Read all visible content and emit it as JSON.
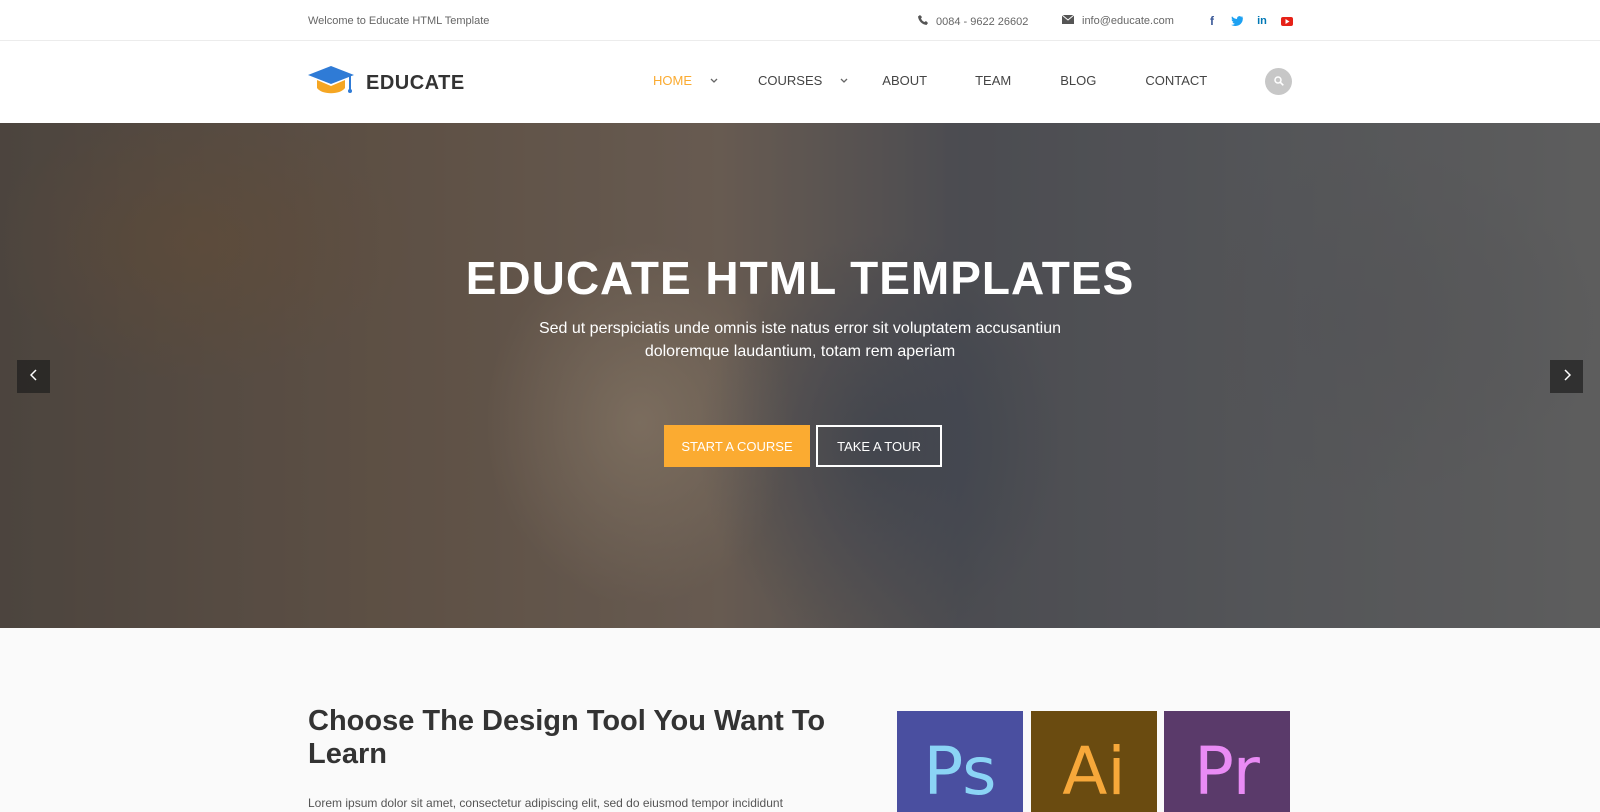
{
  "topbar": {
    "welcome": "Welcome to Educate HTML Template",
    "phone": "0084 - 9622 26602",
    "email": "info@educate.com",
    "socials": [
      {
        "name": "facebook-icon",
        "glyph": "f",
        "color": "#3b5998"
      },
      {
        "name": "twitter-icon",
        "glyph": "t",
        "color": "#1da1f2"
      },
      {
        "name": "linkedin-icon",
        "glyph": "in",
        "color": "#0077b5"
      },
      {
        "name": "youtube-icon",
        "glyph": "▶",
        "color": "#e62117"
      }
    ]
  },
  "header": {
    "logo_text": "EDUCATE",
    "nav": [
      {
        "label": "HOME",
        "has_dropdown": true,
        "active": true
      },
      {
        "label": "COURSES",
        "has_dropdown": true,
        "active": false
      },
      {
        "label": "ABOUT",
        "has_dropdown": false,
        "active": false
      },
      {
        "label": "TEAM",
        "has_dropdown": false,
        "active": false
      },
      {
        "label": "BLOG",
        "has_dropdown": false,
        "active": false
      },
      {
        "label": "CONTACT",
        "has_dropdown": false,
        "active": false
      }
    ]
  },
  "hero": {
    "title": "EDUCATE HTML TEMPLATES",
    "subtitle": "Sed ut perspiciatis unde omnis iste natus error sit voluptatem accusantiun doloremque laudantium, totam rem aperiam",
    "primary_button": "START A COURSE",
    "secondary_button": "TAKE A TOUR"
  },
  "section": {
    "title": "Choose The Design Tool You Want To Learn",
    "text": "Lorem ipsum dolor sit amet, consectetur adipiscing elit, sed do eiusmod tempor incididunt",
    "tools": [
      {
        "label": "Ps",
        "name": "photoshop-tile"
      },
      {
        "label": "Ai",
        "name": "illustrator-tile"
      },
      {
        "label": "Pr",
        "name": "premiere-tile"
      }
    ]
  },
  "colors": {
    "accent": "#fbab31",
    "text_dark": "#333333"
  }
}
